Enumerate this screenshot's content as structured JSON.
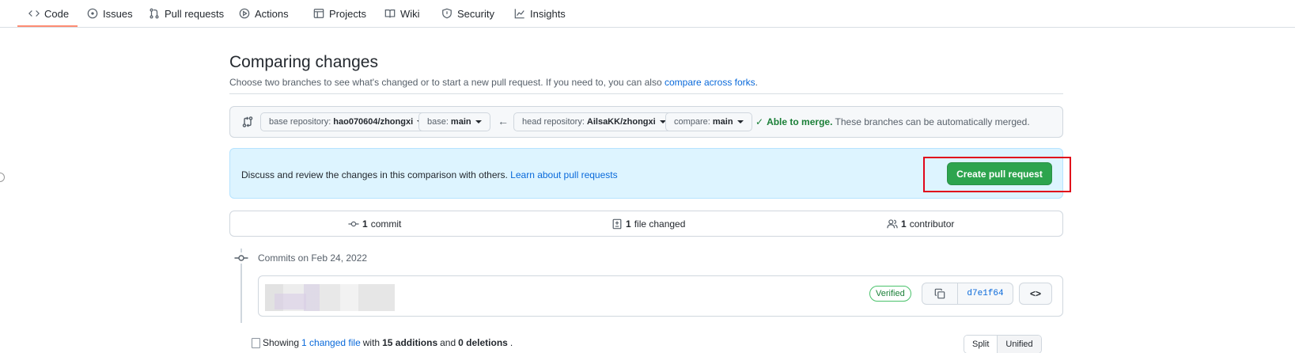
{
  "nav": {
    "items": [
      {
        "label": "Code",
        "icon": "code-icon"
      },
      {
        "label": "Issues",
        "icon": "issue-icon"
      },
      {
        "label": "Pull requests",
        "icon": "pull-request-icon"
      },
      {
        "label": "Actions",
        "icon": "play-icon"
      },
      {
        "label": "Projects",
        "icon": "table-icon"
      },
      {
        "label": "Wiki",
        "icon": "book-icon"
      },
      {
        "label": "Security",
        "icon": "shield-icon"
      },
      {
        "label": "Insights",
        "icon": "graph-icon"
      }
    ],
    "active": "Code"
  },
  "page": {
    "title": "Comparing changes",
    "subtitle_prefix": "Choose two branches to see what's changed or to start a new pull request. If you need to, you can also ",
    "subtitle_link": "compare across forks",
    "subtitle_suffix": "."
  },
  "compare": {
    "base_repo_label": "base repository:",
    "base_repo_value": "hao070604/zhongxi",
    "base_label": "base:",
    "base_value": "main",
    "head_repo_label": "head repository:",
    "head_repo_value": "AilsaKK/zhongxi",
    "compare_label": "compare:",
    "compare_value": "main",
    "merge_ok": "Able to merge.",
    "merge_text": " These branches can be automatically merged."
  },
  "flash": {
    "text": "Discuss and review the changes in this comparison with others. ",
    "link": "Learn about pull requests",
    "button": "Create pull request"
  },
  "summary": {
    "commits_count": "1",
    "commits_label": " commit",
    "files_count": "1",
    "files_label": " file changed",
    "contributors_count": "1",
    "contributors_label": " contributor"
  },
  "timeline": {
    "date_heading": "Commits on Feb 24, 2022",
    "commit": {
      "verified": "Verified",
      "sha": "d7e1f64"
    }
  },
  "diff": {
    "showing": "Showing",
    "changed_link": "1 changed file",
    "with": "with",
    "additions": "15 additions",
    "and": "and",
    "deletions": "0 deletions",
    "period": ".",
    "split": "Split",
    "unified": "Unified"
  },
  "colors": {
    "primary_button": "#2da44e",
    "link": "#0969da",
    "flash_bg": "#ddf4ff",
    "highlight_box": "#e0061b",
    "verified": "#1a7f37"
  }
}
